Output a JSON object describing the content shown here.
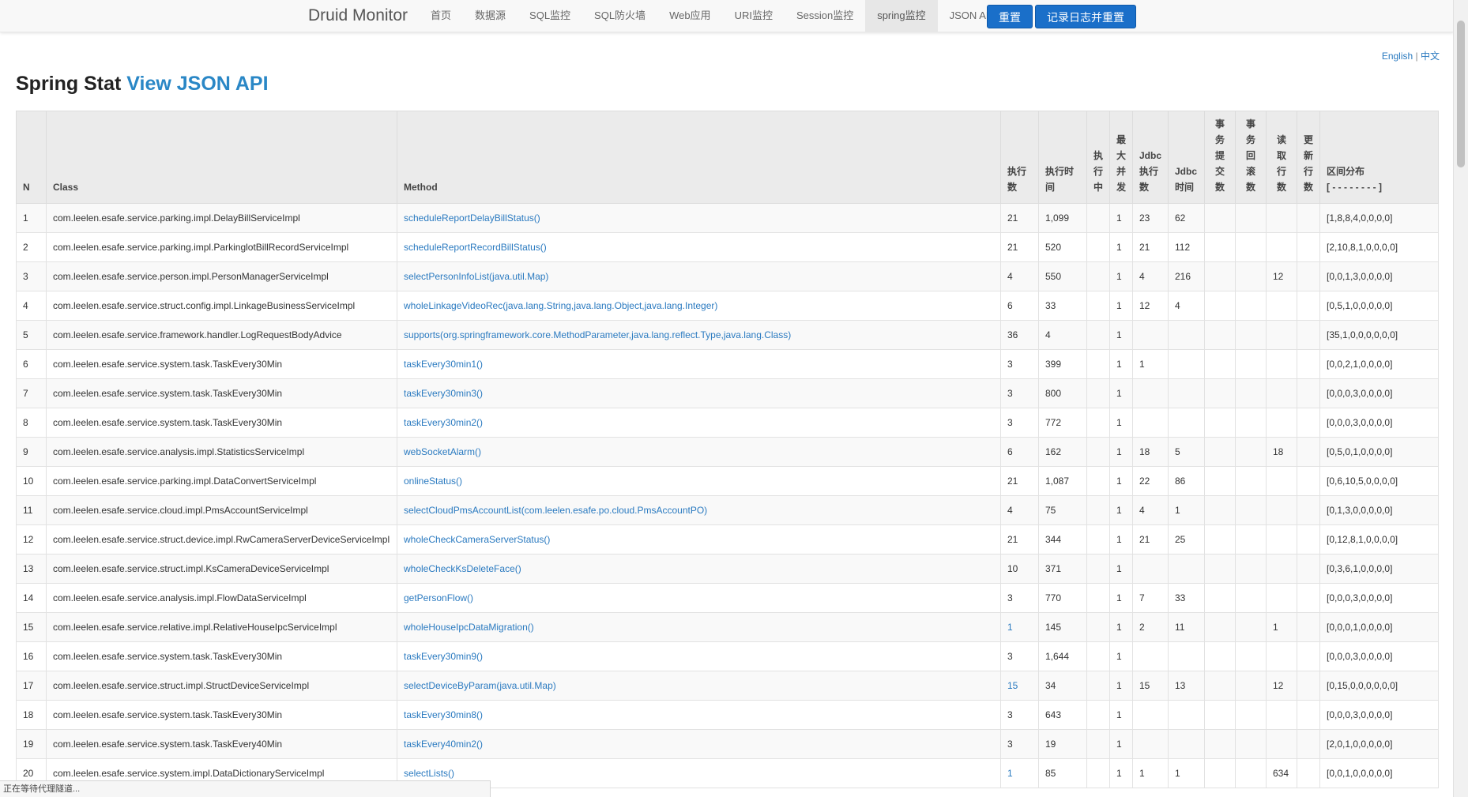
{
  "nav": {
    "brand": "Druid Monitor",
    "items": [
      "首页",
      "数据源",
      "SQL监控",
      "SQL防火墙",
      "Web应用",
      "URI监控",
      "Session监控",
      "spring监控",
      "JSON API"
    ],
    "active": "spring监控",
    "reset_button": "重置",
    "log_reset_button": "记录日志并重置"
  },
  "lang": {
    "english": "English",
    "sep": " | ",
    "chinese": "中文"
  },
  "page": {
    "title": "Spring Stat",
    "json_link": "View JSON API"
  },
  "table": {
    "headers": {
      "n": "N",
      "class": "Class",
      "method": "Method",
      "exec_count": "执行数",
      "exec_time": "执行时间",
      "running": "执行中",
      "max_concurrent": "最大并发",
      "jdbc_exec_count": "Jdbc执行数",
      "jdbc_time": "Jdbc时间",
      "tx_commit": "事务提交数",
      "tx_rollback": "事务回滚数",
      "fetch_rows": "读取行数",
      "update_rows": "更新行数",
      "histogram": "区间分布",
      "histogram_sub": "[ - - - - - - - - ]"
    },
    "rows": [
      {
        "n": "1",
        "class": "com.leelen.esafe.service.parking.impl.DelayBillServiceImpl",
        "method": "scheduleReportDelayBillStatus()",
        "exec_count": "21",
        "exec_time": "1,099",
        "running": "",
        "max_concurrent": "1",
        "jdbc_exec_count": "23",
        "jdbc_time": "62",
        "tx_commit": "",
        "tx_rollback": "",
        "fetch_rows": "",
        "update_rows": "",
        "histogram": "[1,8,8,4,0,0,0,0]"
      },
      {
        "n": "2",
        "class": "com.leelen.esafe.service.parking.impl.ParkinglotBillRecordServiceImpl",
        "method": "scheduleReportRecordBillStatus()",
        "exec_count": "21",
        "exec_time": "520",
        "running": "",
        "max_concurrent": "1",
        "jdbc_exec_count": "21",
        "jdbc_time": "112",
        "tx_commit": "",
        "tx_rollback": "",
        "fetch_rows": "",
        "update_rows": "",
        "histogram": "[2,10,8,1,0,0,0,0]"
      },
      {
        "n": "3",
        "class": "com.leelen.esafe.service.person.impl.PersonManagerServiceImpl",
        "method": "selectPersonInfoList(java.util.Map)",
        "exec_count": "4",
        "exec_time": "550",
        "running": "",
        "max_concurrent": "1",
        "jdbc_exec_count": "4",
        "jdbc_time": "216",
        "tx_commit": "",
        "tx_rollback": "",
        "fetch_rows": "12",
        "update_rows": "",
        "histogram": "[0,0,1,3,0,0,0,0]"
      },
      {
        "n": "4",
        "class": "com.leelen.esafe.service.struct.config.impl.LinkageBusinessServiceImpl",
        "method": "wholeLinkageVideoRec(java.lang.String,java.lang.Object,java.lang.Integer)",
        "exec_count": "6",
        "exec_time": "33",
        "running": "",
        "max_concurrent": "1",
        "jdbc_exec_count": "12",
        "jdbc_time": "4",
        "tx_commit": "",
        "tx_rollback": "",
        "fetch_rows": "",
        "update_rows": "",
        "histogram": "[0,5,1,0,0,0,0,0]"
      },
      {
        "n": "5",
        "class": "com.leelen.esafe.service.framework.handler.LogRequestBodyAdvice",
        "method": "supports(org.springframework.core.MethodParameter,java.lang.reflect.Type,java.lang.Class)",
        "exec_count": "36",
        "exec_time": "4",
        "running": "",
        "max_concurrent": "1",
        "jdbc_exec_count": "",
        "jdbc_time": "",
        "tx_commit": "",
        "tx_rollback": "",
        "fetch_rows": "",
        "update_rows": "",
        "histogram": "[35,1,0,0,0,0,0,0]"
      },
      {
        "n": "6",
        "class": "com.leelen.esafe.service.system.task.TaskEvery30Min",
        "method": "taskEvery30min1()",
        "exec_count": "3",
        "exec_time": "399",
        "running": "",
        "max_concurrent": "1",
        "jdbc_exec_count": "1",
        "jdbc_time": "",
        "tx_commit": "",
        "tx_rollback": "",
        "fetch_rows": "",
        "update_rows": "",
        "histogram": "[0,0,2,1,0,0,0,0]"
      },
      {
        "n": "7",
        "class": "com.leelen.esafe.service.system.task.TaskEvery30Min",
        "method": "taskEvery30min3()",
        "exec_count": "3",
        "exec_time": "800",
        "running": "",
        "max_concurrent": "1",
        "jdbc_exec_count": "",
        "jdbc_time": "",
        "tx_commit": "",
        "tx_rollback": "",
        "fetch_rows": "",
        "update_rows": "",
        "histogram": "[0,0,0,3,0,0,0,0]"
      },
      {
        "n": "8",
        "class": "com.leelen.esafe.service.system.task.TaskEvery30Min",
        "method": "taskEvery30min2()",
        "exec_count": "3",
        "exec_time": "772",
        "running": "",
        "max_concurrent": "1",
        "jdbc_exec_count": "",
        "jdbc_time": "",
        "tx_commit": "",
        "tx_rollback": "",
        "fetch_rows": "",
        "update_rows": "",
        "histogram": "[0,0,0,3,0,0,0,0]"
      },
      {
        "n": "9",
        "class": "com.leelen.esafe.service.analysis.impl.StatisticsServiceImpl",
        "method": "webSocketAlarm()",
        "exec_count": "6",
        "exec_time": "162",
        "running": "",
        "max_concurrent": "1",
        "jdbc_exec_count": "18",
        "jdbc_time": "5",
        "tx_commit": "",
        "tx_rollback": "",
        "fetch_rows": "18",
        "update_rows": "",
        "histogram": "[0,5,0,1,0,0,0,0]"
      },
      {
        "n": "10",
        "class": "com.leelen.esafe.service.parking.impl.DataConvertServiceImpl",
        "method": "onlineStatus()",
        "exec_count": "21",
        "exec_time": "1,087",
        "running": "",
        "max_concurrent": "1",
        "jdbc_exec_count": "22",
        "jdbc_time": "86",
        "tx_commit": "",
        "tx_rollback": "",
        "fetch_rows": "",
        "update_rows": "",
        "histogram": "[0,6,10,5,0,0,0,0]"
      },
      {
        "n": "11",
        "class": "com.leelen.esafe.service.cloud.impl.PmsAccountServiceImpl",
        "method": "selectCloudPmsAccountList(com.leelen.esafe.po.cloud.PmsAccountPO)",
        "exec_count": "4",
        "exec_time": "75",
        "running": "",
        "max_concurrent": "1",
        "jdbc_exec_count": "4",
        "jdbc_time": "1",
        "tx_commit": "",
        "tx_rollback": "",
        "fetch_rows": "",
        "update_rows": "",
        "histogram": "[0,1,3,0,0,0,0,0]"
      },
      {
        "n": "12",
        "class": "com.leelen.esafe.service.struct.device.impl.RwCameraServerDeviceServiceImpl",
        "method": "wholeCheckCameraServerStatus()",
        "exec_count": "21",
        "exec_time": "344",
        "running": "",
        "max_concurrent": "1",
        "jdbc_exec_count": "21",
        "jdbc_time": "25",
        "tx_commit": "",
        "tx_rollback": "",
        "fetch_rows": "",
        "update_rows": "",
        "histogram": "[0,12,8,1,0,0,0,0]"
      },
      {
        "n": "13",
        "class": "com.leelen.esafe.service.struct.impl.KsCameraDeviceServiceImpl",
        "method": "wholeCheckKsDeleteFace()",
        "exec_count": "10",
        "exec_time": "371",
        "running": "",
        "max_concurrent": "1",
        "jdbc_exec_count": "",
        "jdbc_time": "",
        "tx_commit": "",
        "tx_rollback": "",
        "fetch_rows": "",
        "update_rows": "",
        "histogram": "[0,3,6,1,0,0,0,0]"
      },
      {
        "n": "14",
        "class": "com.leelen.esafe.service.analysis.impl.FlowDataServiceImpl",
        "method": "getPersonFlow()",
        "exec_count": "3",
        "exec_time": "770",
        "running": "",
        "max_concurrent": "1",
        "jdbc_exec_count": "7",
        "jdbc_time": "33",
        "tx_commit": "",
        "tx_rollback": "",
        "fetch_rows": "",
        "update_rows": "",
        "histogram": "[0,0,0,3,0,0,0,0]"
      },
      {
        "n": "15",
        "class": "com.leelen.esafe.service.relative.impl.RelativeHouseIpcServiceImpl",
        "method": "wholeHouseIpcDataMigration()",
        "exec_count": "1",
        "exec_time": "145",
        "running": "",
        "max_concurrent": "1",
        "jdbc_exec_count": "2",
        "jdbc_time": "11",
        "tx_commit": "",
        "tx_rollback": "",
        "fetch_rows": "1",
        "update_rows": "",
        "histogram": "[0,0,0,1,0,0,0,0]",
        "exec_blue": true
      },
      {
        "n": "16",
        "class": "com.leelen.esafe.service.system.task.TaskEvery30Min",
        "method": "taskEvery30min9()",
        "exec_count": "3",
        "exec_time": "1,644",
        "running": "",
        "max_concurrent": "1",
        "jdbc_exec_count": "",
        "jdbc_time": "",
        "tx_commit": "",
        "tx_rollback": "",
        "fetch_rows": "",
        "update_rows": "",
        "histogram": "[0,0,0,3,0,0,0,0]"
      },
      {
        "n": "17",
        "class": "com.leelen.esafe.service.struct.impl.StructDeviceServiceImpl",
        "method": "selectDeviceByParam(java.util.Map)",
        "exec_count": "15",
        "exec_time": "34",
        "running": "",
        "max_concurrent": "1",
        "jdbc_exec_count": "15",
        "jdbc_time": "13",
        "tx_commit": "",
        "tx_rollback": "",
        "fetch_rows": "12",
        "update_rows": "",
        "histogram": "[0,15,0,0,0,0,0,0]",
        "exec_blue": true
      },
      {
        "n": "18",
        "class": "com.leelen.esafe.service.system.task.TaskEvery30Min",
        "method": "taskEvery30min8()",
        "exec_count": "3",
        "exec_time": "643",
        "running": "",
        "max_concurrent": "1",
        "jdbc_exec_count": "",
        "jdbc_time": "",
        "tx_commit": "",
        "tx_rollback": "",
        "fetch_rows": "",
        "update_rows": "",
        "histogram": "[0,0,0,3,0,0,0,0]"
      },
      {
        "n": "19",
        "class": "com.leelen.esafe.service.system.task.TaskEvery40Min",
        "method": "taskEvery40min2()",
        "exec_count": "3",
        "exec_time": "19",
        "running": "",
        "max_concurrent": "1",
        "jdbc_exec_count": "",
        "jdbc_time": "",
        "tx_commit": "",
        "tx_rollback": "",
        "fetch_rows": "",
        "update_rows": "",
        "histogram": "[2,0,1,0,0,0,0,0]"
      },
      {
        "n": "20",
        "class": "com.leelen.esafe.service.system.impl.DataDictionaryServiceImpl",
        "method": "selectLists()",
        "exec_count": "1",
        "exec_time": "85",
        "running": "",
        "max_concurrent": "1",
        "jdbc_exec_count": "1",
        "jdbc_time": "1",
        "tx_commit": "",
        "tx_rollback": "",
        "fetch_rows": "634",
        "update_rows": "",
        "histogram": "[0,0,1,0,0,0,0,0]",
        "exec_blue": true
      }
    ]
  },
  "status_bar": "正在等待代理隧道..."
}
